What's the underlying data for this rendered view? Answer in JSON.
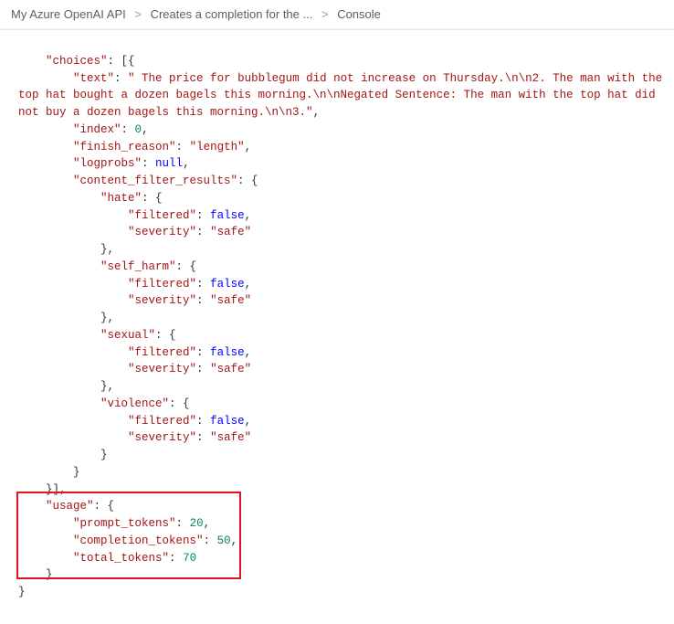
{
  "breadcrumb": {
    "item1": "My Azure OpenAI API",
    "item2": "Creates a completion for the ...",
    "item3": "Console"
  },
  "json_response": {
    "choices_key": "\"choices\"",
    "text_key": "\"text\"",
    "text_value": "\" The price for bubblegum did not increase on Thursday.\\n\\n2. The man with the top hat bought a dozen bagels this morning.\\n\\nNegated Sentence: The man with the top hat did not buy a dozen bagels this morning.\\n\\n3.\"",
    "index_key": "\"index\"",
    "index_value": "0",
    "finish_reason_key": "\"finish_reason\"",
    "finish_reason_value": "\"length\"",
    "logprobs_key": "\"logprobs\"",
    "logprobs_value": "null",
    "content_filter_results_key": "\"content_filter_results\"",
    "hate_key": "\"hate\"",
    "self_harm_key": "\"self_harm\"",
    "sexual_key": "\"sexual\"",
    "violence_key": "\"violence\"",
    "filtered_key": "\"filtered\"",
    "filtered_value": "false",
    "severity_key": "\"severity\"",
    "severity_value": "\"safe\"",
    "usage_key": "\"usage\"",
    "prompt_tokens_key": "\"prompt_tokens\"",
    "prompt_tokens_value": "20",
    "completion_tokens_key": "\"completion_tokens\"",
    "completion_tokens_value": "50",
    "total_tokens_key": "\"total_tokens\"",
    "total_tokens_value": "70"
  }
}
